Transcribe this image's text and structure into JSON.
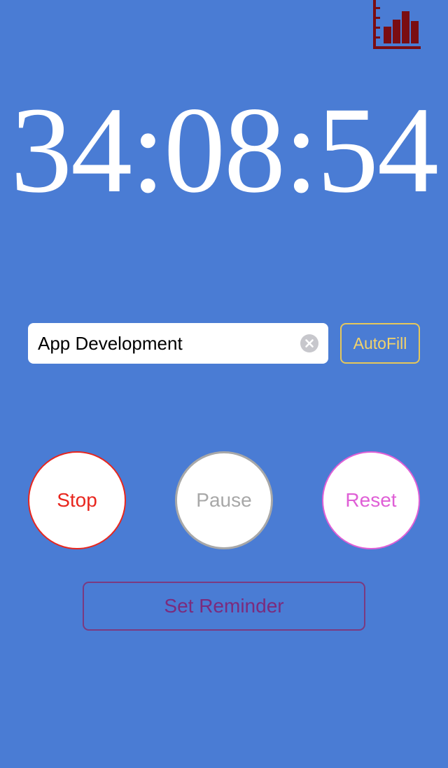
{
  "header": {
    "stats_icon": "bar-chart-icon"
  },
  "timer": {
    "display": "34:08:54"
  },
  "task": {
    "value": "App Development",
    "clear_icon": "clear-circle-icon",
    "autofill_label": "AutoFill"
  },
  "controls": {
    "stop_label": "Stop",
    "pause_label": "Pause",
    "reset_label": "Reset"
  },
  "reminder": {
    "label": "Set Reminder"
  },
  "colors": {
    "background": "#4a7cd4",
    "stats_icon": "#7a0d12",
    "autofill": "#e6c75a",
    "stop": "#e8261e",
    "pause": "#a8a8a8",
    "reset": "#df5fd6",
    "reminder": "#7b3a80"
  }
}
